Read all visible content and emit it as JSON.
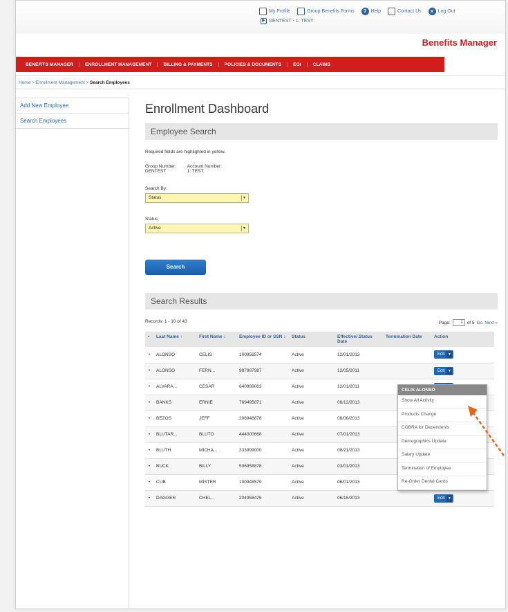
{
  "header": {
    "links": [
      {
        "label": "My Profile",
        "icon": "profile-icon"
      },
      {
        "label": "Group Benefits Forms",
        "icon": "forms-icon"
      },
      {
        "label": "Help",
        "icon": "help-icon"
      },
      {
        "label": "Contact Us",
        "icon": "contact-icon"
      },
      {
        "label": "Log Out",
        "icon": "logout-icon"
      }
    ],
    "group_context": "DENTEST - 1: TEST",
    "brand": "Benefits Manager"
  },
  "nav": {
    "items": [
      "BENEFITS MANAGER",
      "ENROLLMENT MANAGEMENT",
      "BILLING & PAYMENTS",
      "POLICIES & DOCUMENTS",
      "EOI",
      "CLAIMS"
    ]
  },
  "breadcrumb": {
    "home": "Home",
    "section": "Enrollment Management",
    "current": "Search Employees"
  },
  "sidebar": {
    "items": [
      "Add New Employee",
      "Search Employees"
    ]
  },
  "main": {
    "title": "Enrollment Dashboard",
    "search_section": "Employee Search",
    "required_note": "Required fields are highlighted in yellow.",
    "group_number_label": "Group Number:",
    "group_number": "DENTEST",
    "account_number_label": "Account Number:",
    "account_number": "1: TEST",
    "search_by_label": "Search By:",
    "search_by_value": "Status",
    "status_label": "Status",
    "status_value": "Active",
    "search_button": "Search",
    "results_section": "Search Results",
    "records_text": "Records: 1 - 10 of 43",
    "page_label": "Page:",
    "page_value": "1",
    "page_of": "of 5",
    "go_label": "Go",
    "next_label": "Next »"
  },
  "table": {
    "headers": [
      "Last Name ↑",
      "First Name ↕",
      "Employee ID or SSN ↕",
      "Status",
      "Effective/ Status Date",
      "Termination Date",
      "Action"
    ],
    "rows": [
      {
        "last": "ALONSO",
        "first": "CELIS",
        "id": "100958574",
        "status": "Active",
        "date": "12/01/2013",
        "term": "",
        "action": "Edit"
      },
      {
        "last": "ALONSO",
        "first": "FERN...",
        "id": "987987987",
        "status": "Active",
        "date": "12/05/2011",
        "term": "",
        "action": "Edit"
      },
      {
        "last": "ALVARA...",
        "first": "CESAR",
        "id": "640989063",
        "status": "Active",
        "date": "12/01/2011",
        "term": "",
        "action": "Edit"
      },
      {
        "last": "BANKS",
        "first": "ERNIE",
        "id": "769495871",
        "status": "Active",
        "date": "06/12/2013",
        "term": "",
        "action": "Edit"
      },
      {
        "last": "BEZOS",
        "first": "JEFF",
        "id": "206948878",
        "status": "Active",
        "date": "08/06/2013",
        "term": "",
        "action": "Edit"
      },
      {
        "last": "BLUTAR...",
        "first": "BLUTO",
        "id": "444000668",
        "status": "Active",
        "date": "07/01/2013",
        "term": "",
        "action": "Edit"
      },
      {
        "last": "BLUTH",
        "first": "MICHA...",
        "id": "333999000",
        "status": "Active",
        "date": "08/21/2013",
        "term": "",
        "action": "Edit"
      },
      {
        "last": "BUCK",
        "first": "BILLY",
        "id": "506958878",
        "status": "Active",
        "date": "03/01/2013",
        "term": "",
        "action": "Edit"
      },
      {
        "last": "CUB",
        "first": "MISTER",
        "id": "100948579",
        "status": "Active",
        "date": "06/01/2013",
        "term": "",
        "action": "Edit"
      },
      {
        "last": "DAGGER",
        "first": "CHEL...",
        "id": "204958475",
        "status": "Active",
        "date": "06/15/2013",
        "term": "",
        "action": "Edit"
      }
    ]
  },
  "action_menu": {
    "header": "CELIS ALONSO",
    "items": [
      "Show All Activity",
      "Products Change",
      "COBRA for Dependents",
      "Demographics Update",
      "Salary Update",
      "Termination of Employee",
      "Re-Order Dental Cards"
    ]
  },
  "colors": {
    "brand_red": "#d21d1d",
    "link_blue": "#2b63a8",
    "required_yellow": "#fdf6b2",
    "annotation_orange": "#e8641e"
  }
}
